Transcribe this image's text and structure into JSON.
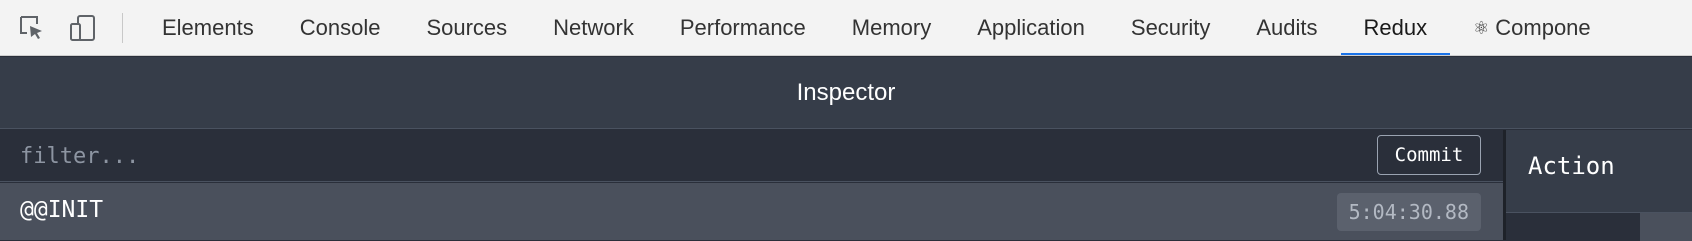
{
  "devtools": {
    "tools": [
      {
        "icon": "inspect-element-icon"
      },
      {
        "icon": "device-toolbar-icon"
      }
    ],
    "tabs": [
      {
        "label": "Elements"
      },
      {
        "label": "Console"
      },
      {
        "label": "Sources"
      },
      {
        "label": "Network"
      },
      {
        "label": "Performance"
      },
      {
        "label": "Memory"
      },
      {
        "label": "Application"
      },
      {
        "label": "Security"
      },
      {
        "label": "Audits"
      },
      {
        "label": "Redux",
        "active": true
      },
      {
        "label": "Compone",
        "glyph": "⚛"
      }
    ]
  },
  "redux": {
    "header_title": "Inspector",
    "filter": {
      "placeholder": "filter...",
      "value": ""
    },
    "commit_label": "Commit",
    "actions": [
      {
        "name": "@@INIT",
        "time": "5:04:30.88"
      }
    ],
    "right_panel": {
      "title": "Action"
    }
  },
  "colors": {
    "tab_active_indicator": "#1a73e8",
    "panel_background": "#2a2f3a",
    "header_background": "#363d49",
    "selected_row": "#4a505c"
  }
}
